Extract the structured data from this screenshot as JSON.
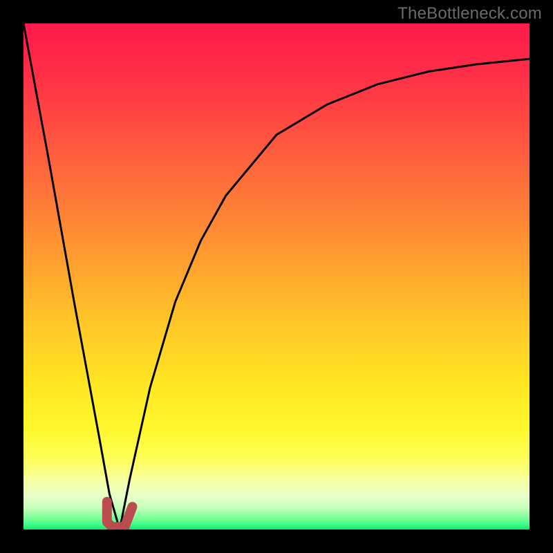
{
  "watermark": "TheBottleneck.com",
  "colors": {
    "frame": "#000000",
    "curve_stroke": "#000000",
    "marker_stroke": "#bb4d4e",
    "gradient_stops": [
      {
        "offset": 0.0,
        "color": "#ff1a4b"
      },
      {
        "offset": 0.1,
        "color": "#ff2e47"
      },
      {
        "offset": 0.22,
        "color": "#ff5240"
      },
      {
        "offset": 0.35,
        "color": "#ff7a38"
      },
      {
        "offset": 0.48,
        "color": "#ffa22f"
      },
      {
        "offset": 0.6,
        "color": "#ffc927"
      },
      {
        "offset": 0.72,
        "color": "#ffe823"
      },
      {
        "offset": 0.8,
        "color": "#fff82d"
      },
      {
        "offset": 0.86,
        "color": "#fdff57"
      },
      {
        "offset": 0.905,
        "color": "#f7ffa5"
      },
      {
        "offset": 0.935,
        "color": "#e7ffc9"
      },
      {
        "offset": 0.958,
        "color": "#c1ffb9"
      },
      {
        "offset": 0.975,
        "color": "#86ff9d"
      },
      {
        "offset": 0.99,
        "color": "#3cff85"
      },
      {
        "offset": 1.0,
        "color": "#14e56f"
      }
    ]
  },
  "chart_data": {
    "type": "line",
    "title": "",
    "xlabel": "",
    "ylabel": "",
    "xlim": [
      0,
      1
    ],
    "ylim": [
      0,
      1
    ],
    "grid": false,
    "legend": false,
    "x": [
      0.0,
      0.05,
      0.1,
      0.15,
      0.17,
      0.19,
      0.21,
      0.25,
      0.3,
      0.35,
      0.4,
      0.5,
      0.6,
      0.7,
      0.8,
      0.9,
      1.0
    ],
    "series": [
      {
        "name": "line-left",
        "values": [
          1.0,
          0.73,
          0.45,
          0.18,
          0.07,
          0.0,
          null,
          null,
          null,
          null,
          null,
          null,
          null,
          null,
          null,
          null,
          null
        ]
      },
      {
        "name": "line-right",
        "values": [
          null,
          null,
          null,
          null,
          null,
          0.0,
          0.1,
          0.28,
          0.45,
          0.57,
          0.66,
          0.78,
          0.84,
          0.88,
          0.905,
          0.92,
          0.93
        ]
      }
    ],
    "marker": {
      "name": "J-marker",
      "path_xy": [
        [
          0.165,
          0.055
        ],
        [
          0.165,
          0.015
        ],
        [
          0.175,
          0.005
        ],
        [
          0.2,
          0.005
        ],
        [
          0.215,
          0.045
        ]
      ]
    }
  }
}
